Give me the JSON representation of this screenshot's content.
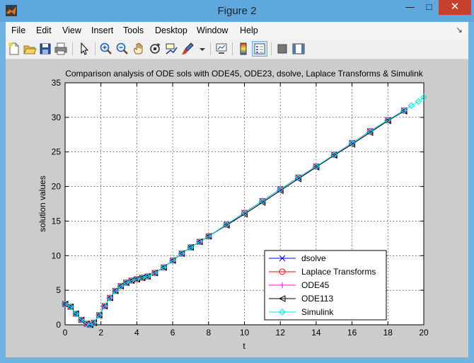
{
  "window": {
    "title": "Figure 2"
  },
  "menu": [
    "File",
    "Edit",
    "View",
    "Insert",
    "Tools",
    "Desktop",
    "Window",
    "Help"
  ],
  "toolbar": {
    "tools": [
      "new-figure-icon",
      "open-file-icon",
      "save-icon",
      "print-icon",
      "pointer-icon",
      "zoom-in-icon",
      "zoom-out-icon",
      "pan-icon",
      "rotate-icon",
      "data-cursor-icon",
      "brush-icon",
      "link-plot-icon",
      "colorbar-icon",
      "legend-icon",
      "hide-plot-tools-icon",
      "show-plot-tools-icon"
    ]
  },
  "chart_data": {
    "type": "line",
    "title": "Comparison analysis of ODE sols with ODE45, ODE23, dsolve, Laplace Transforms & Simulink",
    "xlabel": "t",
    "ylabel": "solution values",
    "xlim": [
      0,
      20
    ],
    "ylim": [
      0,
      35
    ],
    "xticks": [
      0,
      2,
      4,
      6,
      8,
      10,
      12,
      14,
      16,
      18,
      20
    ],
    "yticks": [
      0,
      5,
      10,
      15,
      20,
      25,
      30,
      35
    ],
    "grid": true,
    "legend_position": "bottom-right",
    "legend": [
      "dsolve",
      "Laplace Transforms",
      "ODE45",
      "ODE113",
      "Simulink"
    ],
    "series": [
      {
        "name": "dsolve",
        "color": "#0000ff",
        "marker": "x",
        "x": [
          0,
          0.3,
          0.6,
          0.9,
          1.2,
          1.4,
          1.6,
          1.9,
          2.2,
          2.5,
          2.8,
          3.1,
          3.4,
          3.7,
          4.0,
          4.3,
          4.6,
          5.0,
          5.5,
          6.0,
          6.5,
          7.0,
          7.5,
          8.0,
          9.0,
          10.0,
          11.0,
          12.0,
          13.0,
          14.0,
          15.0,
          16.0,
          17.0,
          18.0,
          18.9
        ],
        "y": [
          3.0,
          2.6,
          1.6,
          0.7,
          0.15,
          0.0,
          0.3,
          1.4,
          2.7,
          3.9,
          4.9,
          5.6,
          6.1,
          6.4,
          6.6,
          6.8,
          7.0,
          7.5,
          8.3,
          9.3,
          10.3,
          11.2,
          12.0,
          12.8,
          14.5,
          16.2,
          17.9,
          19.6,
          21.3,
          22.9,
          24.6,
          26.3,
          28.0,
          29.6,
          31.0
        ]
      },
      {
        "name": "Laplace Transforms",
        "color": "#ff0000",
        "marker": "o",
        "x": [
          0,
          0.3,
          0.6,
          0.9,
          1.2,
          1.4,
          1.6,
          1.9,
          2.2,
          2.5,
          2.8,
          3.1,
          3.4,
          3.7,
          4.0,
          4.3,
          4.6,
          5.0,
          5.5,
          6.0,
          6.5,
          7.0,
          7.5,
          8.0,
          9.0,
          10.0,
          11.0,
          12.0,
          13.0,
          14.0,
          15.0,
          16.0,
          17.0,
          18.0,
          18.9
        ],
        "y": [
          3.0,
          2.6,
          1.6,
          0.7,
          0.15,
          0.0,
          0.3,
          1.4,
          2.7,
          3.9,
          4.9,
          5.6,
          6.1,
          6.4,
          6.6,
          6.8,
          7.0,
          7.5,
          8.3,
          9.3,
          10.3,
          11.2,
          12.0,
          12.8,
          14.5,
          16.2,
          17.9,
          19.6,
          21.3,
          22.9,
          24.6,
          26.3,
          28.0,
          29.6,
          31.0
        ]
      },
      {
        "name": "ODE45",
        "color": "#ff00ff",
        "marker": "+",
        "x": [
          0,
          0.3,
          0.6,
          0.9,
          1.2,
          1.4,
          1.6,
          1.9,
          2.2,
          2.5,
          2.8,
          3.1,
          3.4,
          3.7,
          4.0,
          4.3,
          4.6,
          5.0,
          5.5,
          6.0,
          6.5,
          7.0,
          7.5,
          8.0,
          9.0,
          10.0,
          11.0,
          12.0,
          13.0,
          14.0,
          15.0,
          16.0,
          17.0,
          18.0,
          18.9
        ],
        "y": [
          3.0,
          2.6,
          1.6,
          0.7,
          0.15,
          0.0,
          0.3,
          1.4,
          2.7,
          3.9,
          4.9,
          5.6,
          6.1,
          6.4,
          6.6,
          6.8,
          7.0,
          7.5,
          8.3,
          9.3,
          10.3,
          11.2,
          12.0,
          12.8,
          14.5,
          16.2,
          17.9,
          19.6,
          21.3,
          22.9,
          24.6,
          26.3,
          28.0,
          29.6,
          31.0
        ]
      },
      {
        "name": "ODE113",
        "color": "#000000",
        "marker": "triangle-left",
        "x": [
          0,
          0.3,
          0.6,
          0.9,
          1.2,
          1.4,
          1.6,
          1.9,
          2.2,
          2.5,
          2.8,
          3.1,
          3.4,
          3.7,
          4.0,
          4.3,
          4.6,
          5.0,
          5.5,
          6.0,
          6.5,
          7.0,
          7.5,
          8.0,
          9.0,
          10.0,
          11.0,
          12.0,
          13.0,
          14.0,
          15.0,
          16.0,
          17.0,
          18.0,
          18.9
        ],
        "y": [
          3.0,
          2.6,
          1.6,
          0.7,
          0.15,
          0.0,
          0.3,
          1.4,
          2.7,
          3.9,
          4.9,
          5.6,
          6.1,
          6.4,
          6.6,
          6.8,
          7.0,
          7.5,
          8.3,
          9.3,
          10.3,
          11.2,
          12.0,
          12.8,
          14.4,
          16.0,
          17.7,
          19.4,
          21.1,
          22.8,
          24.5,
          26.1,
          27.8,
          29.5,
          30.9
        ]
      },
      {
        "name": "Simulink",
        "color": "#00e5e5",
        "marker": "diamond",
        "x": [
          0,
          0.3,
          0.6,
          0.9,
          1.2,
          1.4,
          1.6,
          1.9,
          2.2,
          2.5,
          2.8,
          3.1,
          3.4,
          3.7,
          4.0,
          4.3,
          4.6,
          5.0,
          5.5,
          6.0,
          6.5,
          7.0,
          7.5,
          8.0,
          9.0,
          10.0,
          11.0,
          12.0,
          13.0,
          14.0,
          15.0,
          16.0,
          17.0,
          18.0,
          18.9,
          19.3,
          19.7,
          20.0
        ],
        "y": [
          3.0,
          2.6,
          1.6,
          0.7,
          0.15,
          0.0,
          0.3,
          1.4,
          2.7,
          3.9,
          4.9,
          5.6,
          6.1,
          6.4,
          6.6,
          6.8,
          7.0,
          7.5,
          8.3,
          9.3,
          10.3,
          11.2,
          12.0,
          12.8,
          14.5,
          16.2,
          17.9,
          19.6,
          21.3,
          22.9,
          24.6,
          26.3,
          28.0,
          29.6,
          31.0,
          31.7,
          32.3,
          32.9
        ]
      }
    ]
  }
}
